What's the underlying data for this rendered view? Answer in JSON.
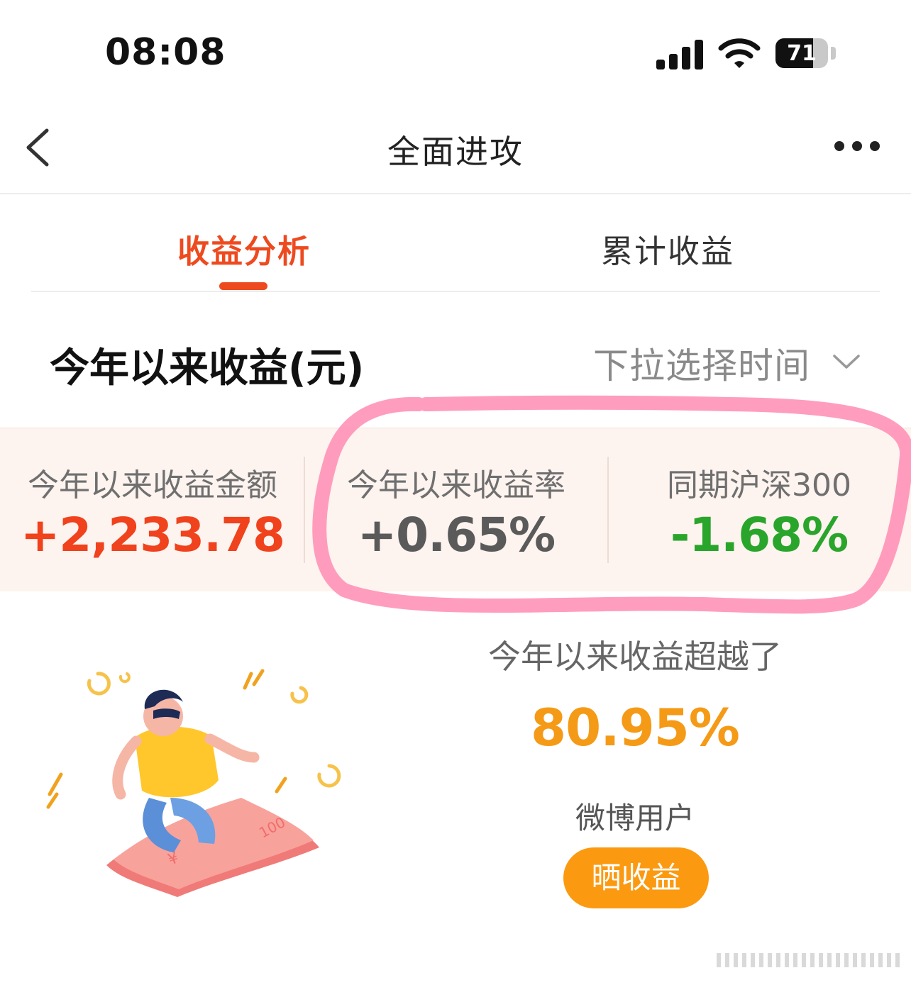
{
  "status_bar": {
    "time": "08:08",
    "battery_percent": 71,
    "battery_text": "71"
  },
  "nav": {
    "title": "全面进攻"
  },
  "tabs": [
    {
      "label": "收益分析",
      "active": true
    },
    {
      "label": "累计收益",
      "active": false
    }
  ],
  "section": {
    "title": "今年以来收益(元)",
    "period_label": "下拉选择时间"
  },
  "stats": [
    {
      "label": "今年以来收益金额",
      "value": "+2,233.78",
      "color": "#f0421c"
    },
    {
      "label": "今年以来收益率",
      "value": "+0.65%",
      "color": "#5a5a5a"
    },
    {
      "label": "同期沪深300",
      "value": "-1.68%",
      "color": "#2aa52b"
    }
  ],
  "beat": {
    "label": "今年以来收益超越了",
    "value": "80.95%",
    "users": "微博用户"
  },
  "share_button": {
    "label": "晒收益"
  },
  "illustration": {
    "banknote_text": "100",
    "currency_symbol": "¥"
  },
  "colors": {
    "accent": "#ee4a1f",
    "highlight_stroke": "#ff8fb6",
    "share": "#fb9a11"
  }
}
